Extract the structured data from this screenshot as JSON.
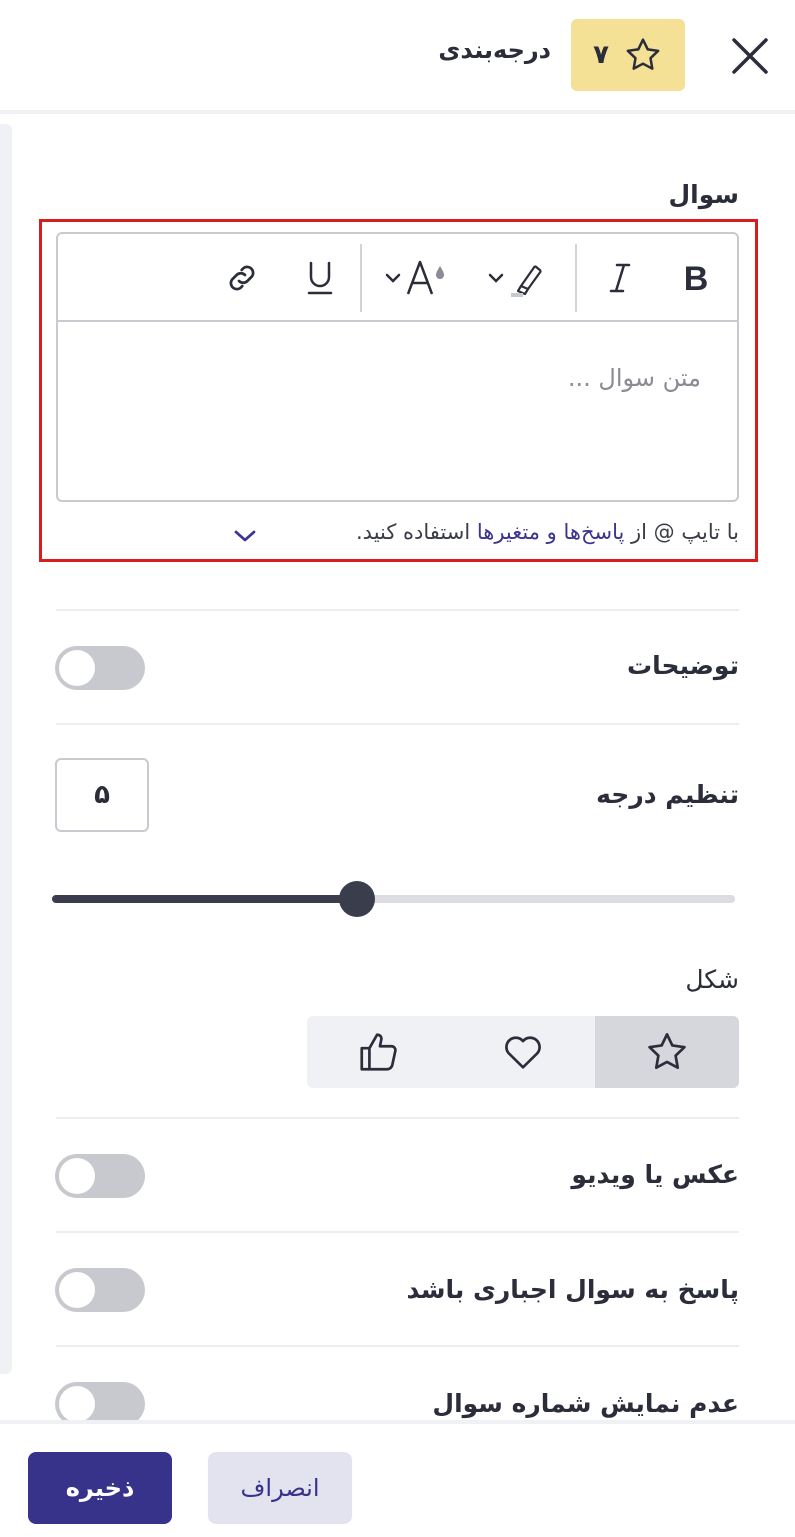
{
  "header": {
    "title": "درجه‌بندی",
    "question_number": "۷"
  },
  "question": {
    "label": "سوال",
    "placeholder": "متن سوال ...",
    "hint_prefix": "با تایپ @ از ",
    "hint_link": "پاسخ‌ها و متغیرها",
    "hint_suffix": " استفاده کنید."
  },
  "settings": {
    "description_label": "توضیحات",
    "grade_label": "تنظیم درجه",
    "grade_value": "۵",
    "slider_fraction": 0.447,
    "shape_label": "شکل",
    "shape_selected": "star-icon",
    "media_label": "عکس یا ویدیو",
    "required_label": "پاسخ به سوال اجباری باشد",
    "hide_number_label": "عدم نمایش شماره سوال"
  },
  "footer": {
    "save": "ذخیره",
    "cancel": "انصراف"
  },
  "colors": {
    "accent": "#38338a",
    "badge": "#f5e196",
    "highlight": "#d91c1c"
  }
}
